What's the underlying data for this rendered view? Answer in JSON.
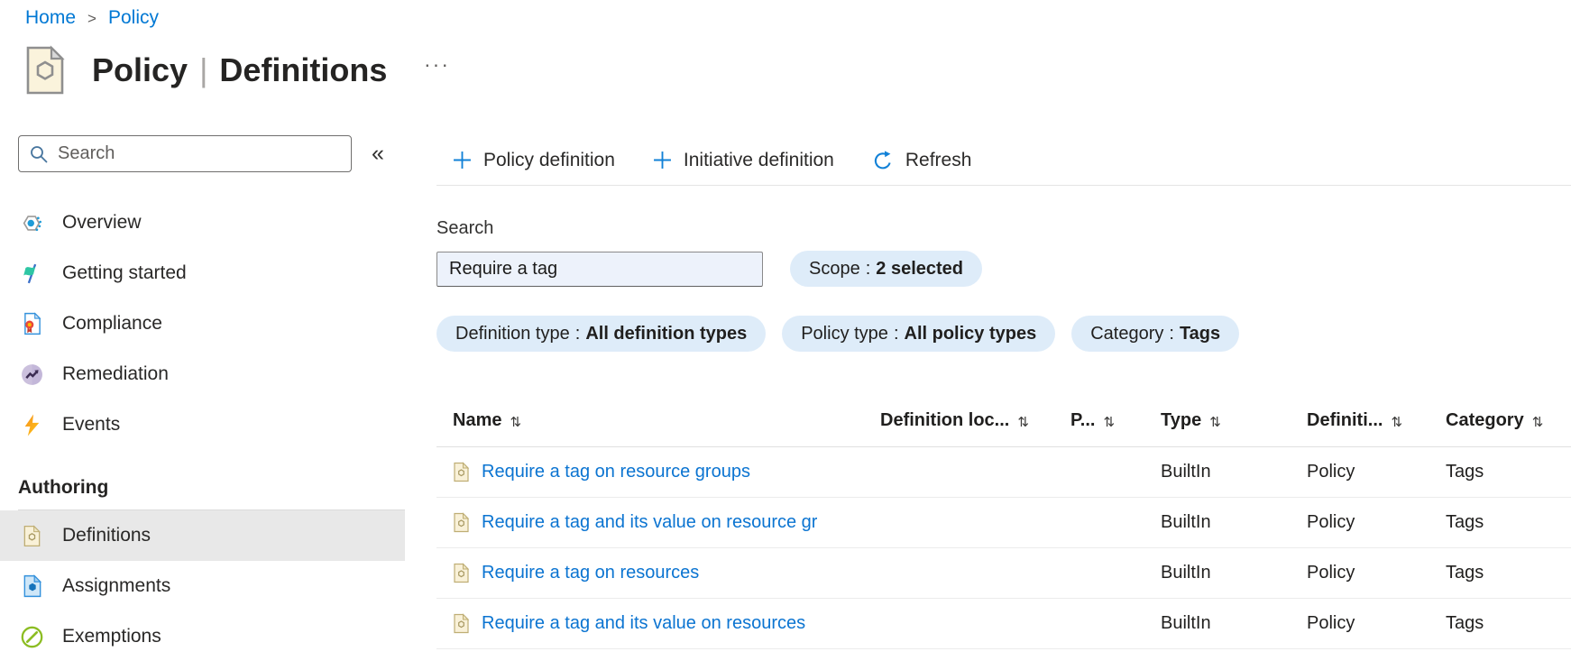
{
  "breadcrumb": {
    "home": "Home",
    "separator": ">",
    "current": "Policy"
  },
  "header": {
    "title_bold": "Policy",
    "separator": "|",
    "title_rest": "Definitions",
    "more_glyph": "···"
  },
  "sidebar": {
    "search_placeholder": "Search",
    "collapse_glyph": "«",
    "items": [
      {
        "label": "Overview",
        "icon": "overview-icon"
      },
      {
        "label": "Getting started",
        "icon": "getting-started-icon"
      },
      {
        "label": "Compliance",
        "icon": "compliance-icon"
      },
      {
        "label": "Remediation",
        "icon": "remediation-icon"
      },
      {
        "label": "Events",
        "icon": "events-icon"
      }
    ],
    "section_label": "Authoring",
    "authoring_items": [
      {
        "label": "Definitions",
        "icon": "definitions-icon",
        "selected": true
      },
      {
        "label": "Assignments",
        "icon": "assignments-icon",
        "selected": false
      },
      {
        "label": "Exemptions",
        "icon": "exemptions-icon",
        "selected": false
      }
    ]
  },
  "toolbar": {
    "items": [
      {
        "label": "Policy definition",
        "icon": "plus-icon"
      },
      {
        "label": "Initiative definition",
        "icon": "plus-icon"
      },
      {
        "label": "Refresh",
        "icon": "refresh-icon"
      }
    ]
  },
  "filters": {
    "search_label": "Search",
    "search_value": "Require a tag",
    "pill_separator": ":",
    "scope": {
      "label": "Scope",
      "value": "2 selected"
    },
    "pills": [
      {
        "label": "Definition type",
        "value": "All definition types"
      },
      {
        "label": "Policy type",
        "value": "All policy types"
      },
      {
        "label": "Category",
        "value": "Tags"
      }
    ]
  },
  "table": {
    "sort_glyph": "⇅",
    "columns": [
      "Name",
      "Definition loc...",
      "P...",
      "Type",
      "Definiti...",
      "Category"
    ],
    "rows": [
      {
        "name": "Require a tag on resource groups",
        "definition_location": "",
        "p": "",
        "type": "BuiltIn",
        "definition_type": "Policy",
        "category": "Tags"
      },
      {
        "name": "Require a tag and its value on resource gr",
        "definition_location": "",
        "p": "",
        "type": "BuiltIn",
        "definition_type": "Policy",
        "category": "Tags"
      },
      {
        "name": "Require a tag on resources",
        "definition_location": "",
        "p": "",
        "type": "BuiltIn",
        "definition_type": "Policy",
        "category": "Tags"
      },
      {
        "name": "Require a tag and its value on resources",
        "definition_location": "",
        "p": "",
        "type": "BuiltIn",
        "definition_type": "Policy",
        "category": "Tags"
      }
    ]
  },
  "icons": {
    "search": "magnifier",
    "collapse": "«",
    "more": "···",
    "sort": "⇅",
    "add": "+",
    "refresh": "circular-arrow",
    "policy_page": "document-with-hexagon"
  },
  "colors": {
    "accent_blue": "#0078d4",
    "link_blue": "#0b74d1",
    "pill_bg": "#deecf9",
    "search_input_bg": "#edf2fb",
    "selected_item_bg": "#e8e8e8",
    "definitions_tan": "#f9f1d8",
    "events_orange": "#f68f1e",
    "exemptions_green": "#8cbd23",
    "remediation_purple": "#cbc0dd",
    "getting_started_teal": "#2ec6a4"
  }
}
